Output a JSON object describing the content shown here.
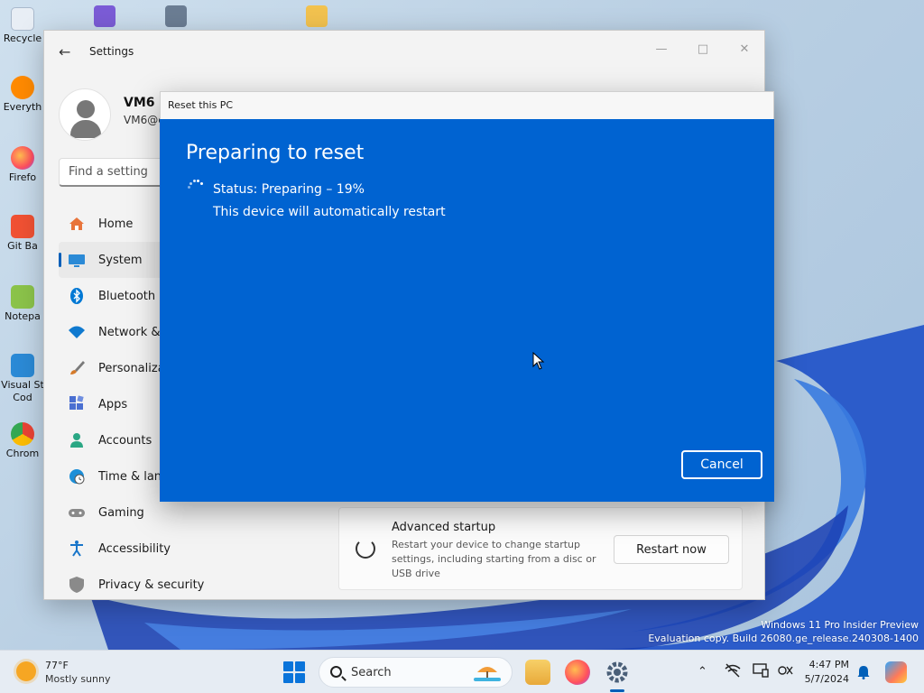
{
  "desktop": {
    "icons": [
      {
        "label": "Recycle",
        "icon": "recycle-bin-icon"
      },
      {
        "label": "Everyth",
        "icon": "everything-search-icon"
      },
      {
        "label": "Firefo",
        "icon": "firefox-icon"
      },
      {
        "label": "Git Ba",
        "icon": "git-bash-icon"
      },
      {
        "label": "Notepa",
        "icon": "notepad-icon"
      },
      {
        "label": "Visual St\nCod",
        "icon": "vscode-icon"
      },
      {
        "label": "Chrom",
        "icon": "chrome-icon"
      }
    ]
  },
  "settings": {
    "title": "Settings",
    "user": {
      "name": "VM6",
      "email": "VM6@c"
    },
    "search_placeholder": "Find a setting",
    "nav": [
      {
        "label": "Home",
        "icon": "home-icon",
        "color": "#e8743b"
      },
      {
        "label": "System",
        "icon": "system-icon",
        "color": "#2b8ad6",
        "active": true
      },
      {
        "label": "Bluetooth &",
        "icon": "bluetooth-icon",
        "color": "#0078d4"
      },
      {
        "label": "Network &",
        "icon": "wifi-icon",
        "color": "#0f79cf"
      },
      {
        "label": "Personaliza",
        "icon": "brush-icon",
        "color": "#d57a2a"
      },
      {
        "label": "Apps",
        "icon": "apps-icon",
        "color": "#4a6fd1"
      },
      {
        "label": "Accounts",
        "icon": "accounts-icon",
        "color": "#2aa784"
      },
      {
        "label": "Time & lang",
        "icon": "globe-clock-icon",
        "color": "#1d8fd8"
      },
      {
        "label": "Gaming",
        "icon": "gamepad-icon",
        "color": "#7a7a7a"
      },
      {
        "label": "Accessibility",
        "icon": "accessibility-icon",
        "color": "#1875c9"
      },
      {
        "label": "Privacy & security",
        "icon": "shield-icon",
        "color": "#8a8a8a"
      }
    ],
    "advanced_startup": {
      "title": "Advanced startup",
      "description": "Restart your device to change startup settings, including starting from a disc or USB drive",
      "button": "Restart now"
    }
  },
  "dialog": {
    "title": "Reset this PC",
    "heading": "Preparing to reset",
    "status": "Status: Preparing – 19%",
    "progress_percent": 19,
    "note": "This device will automatically restart",
    "cancel_label": "Cancel"
  },
  "watermark": {
    "line1": "Windows 11 Pro Insider Preview",
    "line2": "Evaluation copy. Build 26080.ge_release.240308-1400"
  },
  "taskbar": {
    "weather": {
      "temp": "77°F",
      "condition": "Mostly sunny"
    },
    "search_label": "Search",
    "clock": {
      "time": "4:47 PM",
      "date": "5/7/2024"
    },
    "accent": "#005fb8"
  }
}
